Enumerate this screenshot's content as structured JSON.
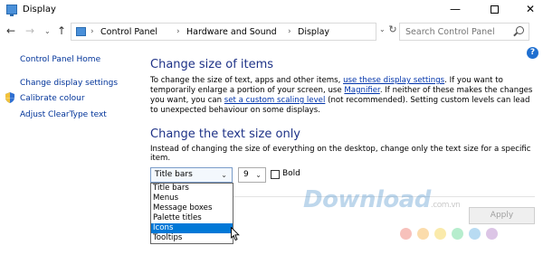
{
  "window": {
    "title": "Display",
    "controls": {
      "minimize": "—",
      "close": "✕"
    }
  },
  "nav": {
    "back": "←",
    "forward": "→",
    "recent": "⌄",
    "up": "↑",
    "breadcrumb": [
      "Control Panel",
      "Hardware and Sound",
      "Display"
    ],
    "separator": "›",
    "dropdown": "⌄",
    "refresh": "↻",
    "search_placeholder": "Search Control Panel"
  },
  "help": "?",
  "sidebar": {
    "home": "Control Panel Home",
    "items": [
      "Change display settings",
      "Calibrate colour",
      "Adjust ClearType text"
    ]
  },
  "main": {
    "heading1": "Change size of items",
    "para1": {
      "t1": "To change the size of text, apps and other items, ",
      "link1": "use these display settings",
      "t2": ". If you want to temporarily enlarge a portion of your screen, use ",
      "link2": "Magnifier",
      "t3": ". If neither of these makes the changes you want, you can ",
      "link3": "set a custom scaling level",
      "t4": " (not recommended). Setting custom levels can lead to unexpected behaviour on some displays."
    },
    "heading2": "Change the text size only",
    "para2": "Instead of changing the size of everything on the desktop, change only the text size for a specific item.",
    "item_select": {
      "value": "Title bars",
      "arrow": "⌄"
    },
    "size_select": {
      "value": "9",
      "arrow": "⌄"
    },
    "bold_label": "Bold",
    "bold_checked": false,
    "apply": "Apply",
    "dropdown_options": [
      "Title bars",
      "Menus",
      "Message boxes",
      "Palette titles",
      "Icons",
      "Tooltips"
    ],
    "dropdown_selected": "Icons"
  },
  "watermark": {
    "text": "Download",
    "suffix": ".com.vn"
  },
  "colors": {
    "heading": "#1e3287",
    "link": "#003399",
    "selection": "#0078d7",
    "watermark_dots": [
      "#e84c3d",
      "#f39c12",
      "#f1c40f",
      "#2ecc71",
      "#3498db",
      "#9b59b6"
    ]
  }
}
